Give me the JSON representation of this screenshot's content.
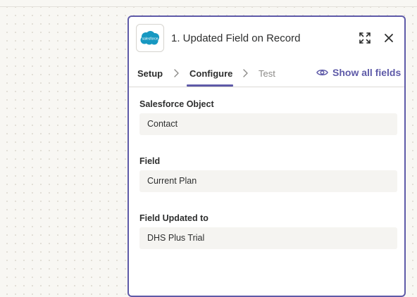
{
  "canvas": {
    "background": "#f8f7f3"
  },
  "panel": {
    "title": "1. Updated Field on Record",
    "app_logo": {
      "icon": "salesforce-logo-icon",
      "text": "salesforce",
      "color": "#1798c1"
    },
    "border_color": "#5e5aa8",
    "header_buttons": {
      "expand_icon": "expand-icon",
      "close_icon": "close-icon"
    }
  },
  "tabs": {
    "items": [
      {
        "label": "Setup",
        "state": "completed"
      },
      {
        "label": "Configure",
        "state": "active"
      },
      {
        "label": "Test",
        "state": "inactive"
      }
    ],
    "show_all_fields": {
      "label": "Show all fields",
      "icon": "eye-icon"
    }
  },
  "fields": [
    {
      "label": "Salesforce Object",
      "value": "Contact"
    },
    {
      "label": "Field",
      "value": "Current Plan"
    },
    {
      "label": "Field Updated to",
      "value": "DHS Plus Trial"
    }
  ]
}
